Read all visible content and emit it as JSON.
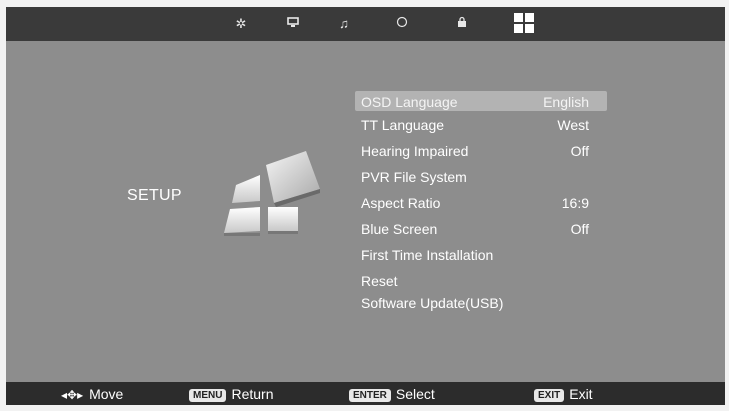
{
  "top_icons": [
    "settings-icon",
    "monitor-icon",
    "music-icon",
    "clock-icon",
    "lock-icon",
    "setup-grid-icon"
  ],
  "section_title": "SETUP",
  "menu": [
    {
      "label": "OSD Language",
      "value": "English",
      "selected": true
    },
    {
      "label": "TT Language",
      "value": "West"
    },
    {
      "label": "Hearing Impaired",
      "value": "Off"
    },
    {
      "label": "PVR File System",
      "value": ""
    },
    {
      "label": "Aspect Ratio",
      "value": "16:9"
    },
    {
      "label": "Blue Screen",
      "value": "Off"
    },
    {
      "label": "First Time Installation",
      "value": ""
    },
    {
      "label": "Reset",
      "value": ""
    },
    {
      "label": "Software Update(USB)",
      "value": ""
    }
  ],
  "footer": {
    "move": "Move",
    "menu_key": "MENU",
    "return": "Return",
    "enter_key": "ENTER",
    "select": "Select",
    "exit_key": "EXIT",
    "exit": "Exit"
  }
}
